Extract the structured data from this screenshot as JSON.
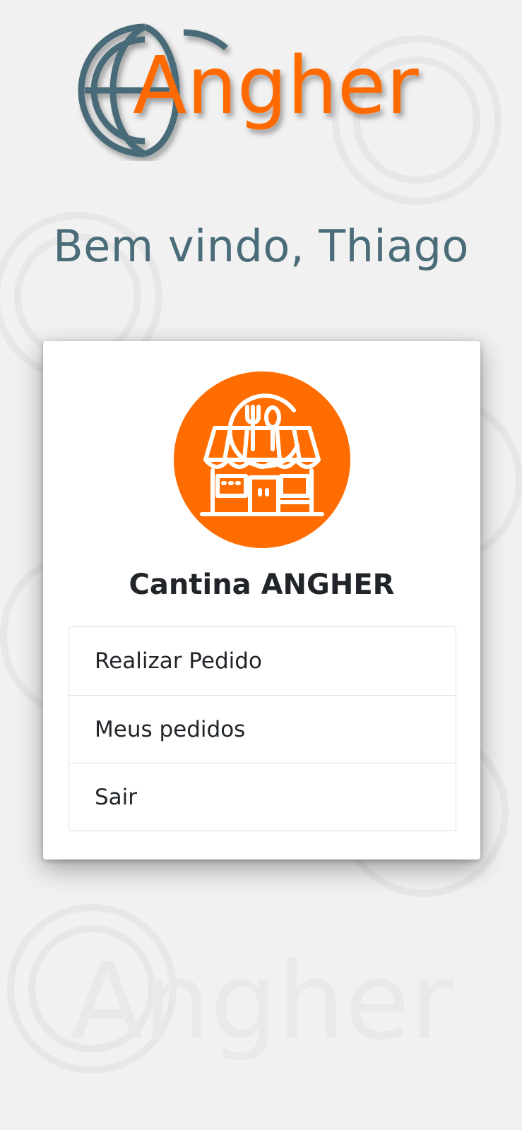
{
  "brand": {
    "logo_text": "Angher",
    "colors": {
      "primary_orange": "#ff6a00",
      "slate": "#4a6b78"
    }
  },
  "welcome": {
    "text": "Bem vindo, Thiago"
  },
  "card": {
    "icon": "restaurant-store-icon",
    "title": "Cantina ANGHER"
  },
  "menu": {
    "items": [
      {
        "label": "Realizar Pedido"
      },
      {
        "label": "Meus pedidos"
      },
      {
        "label": "Sair"
      }
    ]
  }
}
